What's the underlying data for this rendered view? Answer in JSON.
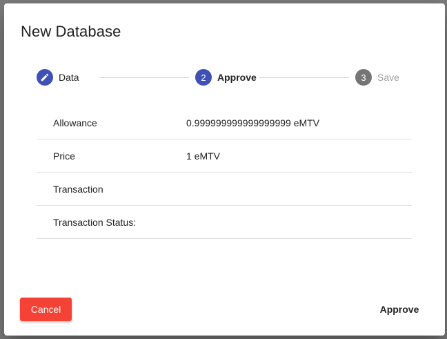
{
  "dialog": {
    "title": "New Database"
  },
  "stepper": {
    "steps": [
      {
        "label": "Data",
        "marker": "",
        "state": "done",
        "icon": "pencil-icon"
      },
      {
        "label": "Approve",
        "marker": "2",
        "state": "active"
      },
      {
        "label": "Save",
        "marker": "3",
        "state": "pending"
      }
    ]
  },
  "details": {
    "rows": [
      {
        "key": "Allowance",
        "value": "0.999999999999999999 eMTV"
      },
      {
        "key": "Price",
        "value": "1 eMTV"
      },
      {
        "key": "Transaction",
        "value": ""
      },
      {
        "key": "Transaction Status:",
        "value": ""
      }
    ]
  },
  "actions": {
    "cancel_label": "Cancel",
    "approve_label": "Approve"
  },
  "colors": {
    "primary": "#3f51b5",
    "warn": "#f44336",
    "pending": "#757575"
  }
}
